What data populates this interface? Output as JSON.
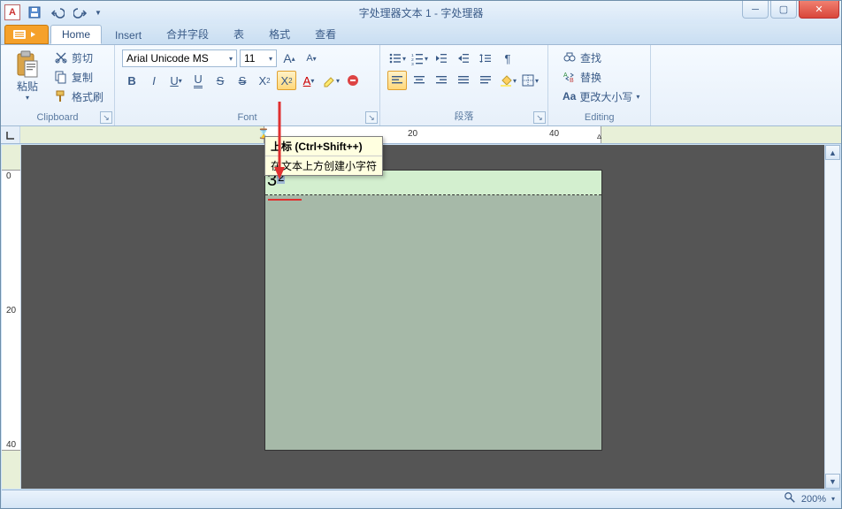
{
  "window": {
    "title": "字处理器文本 1 - 字处理器"
  },
  "qat": {
    "app_glyph": "A"
  },
  "tabs": {
    "home": "Home",
    "insert": "Insert",
    "merge": "合并字段",
    "table": "表",
    "format": "格式",
    "view": "查看"
  },
  "groups": {
    "clipboard": {
      "label": "Clipboard",
      "paste": "粘贴",
      "cut": "剪切",
      "copy": "复制",
      "format_painter": "格式刷"
    },
    "font": {
      "label": "Font",
      "name": "Arial Unicode MS",
      "size": "11"
    },
    "paragraph": {
      "label": "段落"
    },
    "editing": {
      "label": "Editing",
      "find": "查找",
      "replace": "替换",
      "case": "更改大小写"
    }
  },
  "tooltip": {
    "title": "上标 (Ctrl+Shift++)",
    "body": "在文本上方创建小字符"
  },
  "ruler": {
    "ticks": [
      "20",
      "40"
    ]
  },
  "vruler": {
    "ticks": [
      "0",
      "20",
      "40"
    ]
  },
  "document": {
    "base": "3",
    "sup": "2"
  },
  "status": {
    "zoom": "200%"
  }
}
